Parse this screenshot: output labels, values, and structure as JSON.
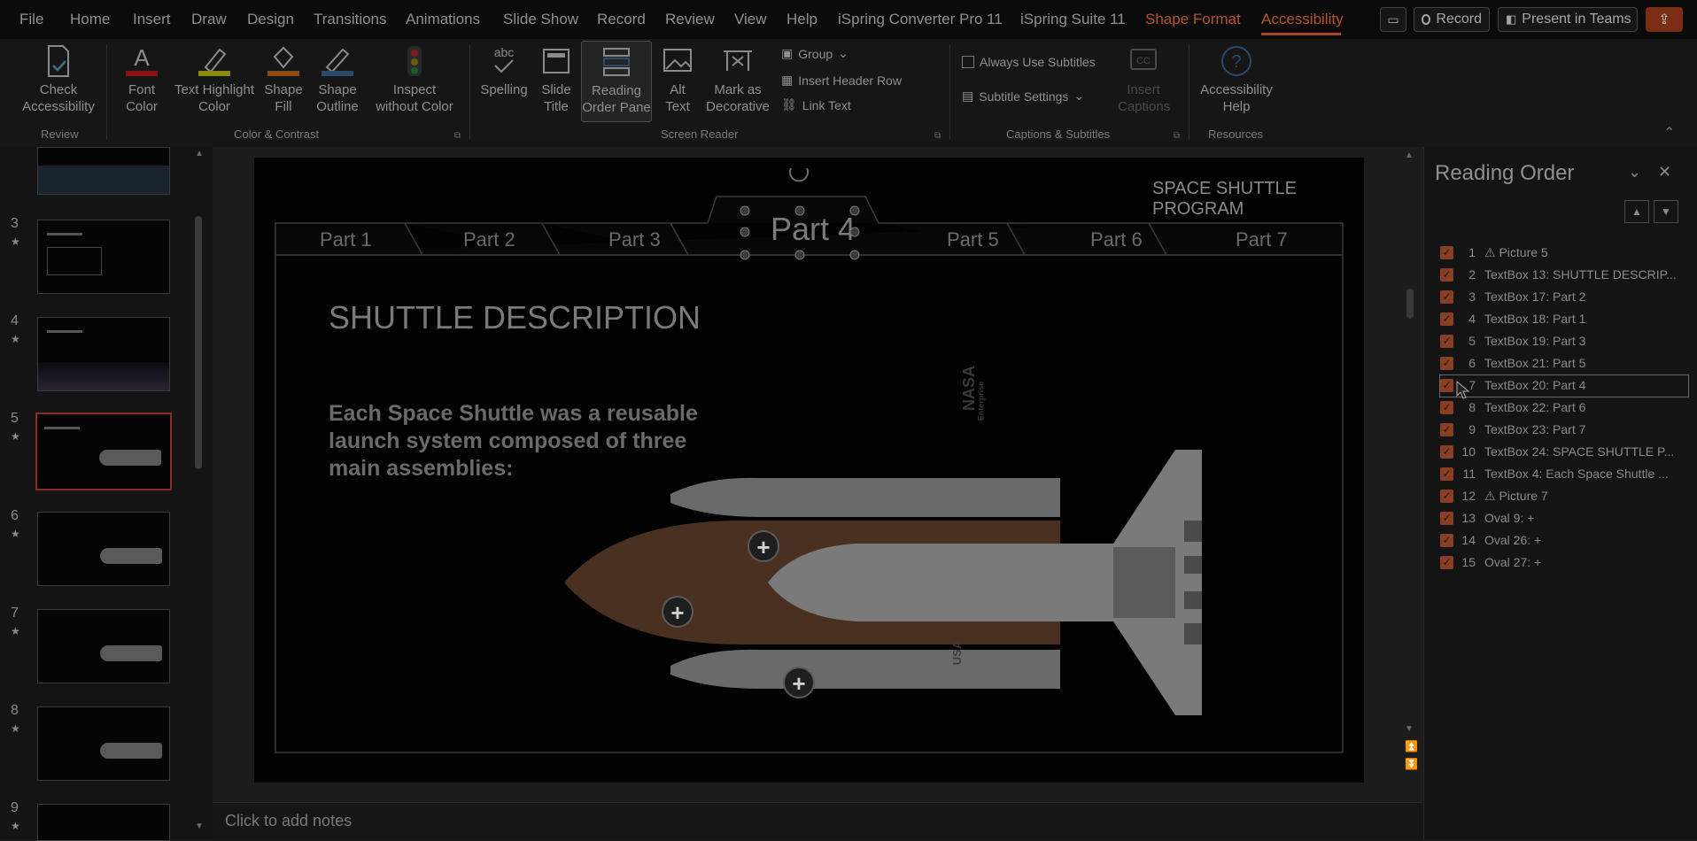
{
  "menubar": {
    "items": [
      "File",
      "Home",
      "Insert",
      "Draw",
      "Design",
      "Transitions",
      "Animations",
      "Slide Show",
      "Record",
      "Review",
      "View",
      "Help",
      "iSpring Converter Pro 11",
      "iSpring Suite 11"
    ],
    "shape_format": "Shape Format",
    "accessibility": "Accessibility",
    "record_btn": "Record",
    "present_btn": "Present in Teams"
  },
  "ribbon": {
    "check_accessibility": "Check\nAccessibility",
    "font_color": "Font\nColor",
    "text_highlight": "Text Highlight\nColor",
    "shape_fill": "Shape\nFill",
    "shape_outline": "Shape\nOutline",
    "inspect": "Inspect\nwithout Color",
    "spelling": "Spelling",
    "slide_title": "Slide\nTitle",
    "reading_order": "Reading\nOrder Pane",
    "alt_text": "Alt\nText",
    "mark_decorative": "Mark as\nDecorative",
    "group": "Group",
    "insert_header_row": "Insert Header Row",
    "link_text": "Link Text",
    "always_subtitles": "Always Use Subtitles",
    "subtitle_settings": "Subtitle Settings",
    "insert_captions": "Insert\nCaptions",
    "accessibility_help": "Accessibility\nHelp",
    "groups": {
      "review": "Review",
      "color_contrast": "Color & Contrast",
      "screen_reader": "Screen Reader",
      "captions": "Captions & Subtitles",
      "resources": "Resources"
    }
  },
  "thumbnails": [
    {
      "num": "3",
      "star": "★"
    },
    {
      "num": "4",
      "star": "★"
    },
    {
      "num": "5",
      "star": "★"
    },
    {
      "num": "6",
      "star": "★"
    },
    {
      "num": "7",
      "star": "★"
    },
    {
      "num": "8",
      "star": "★"
    },
    {
      "num": "9",
      "star": "★"
    }
  ],
  "slide": {
    "program": "SPACE SHUTTLE PROGRAM",
    "tabs": [
      "Part 1",
      "Part 2",
      "Part 3",
      "Part 4",
      "Part 5",
      "Part 6",
      "Part 7"
    ],
    "heading": "SHUTTLE DESCRIPTION",
    "body": "Each Space Shuttle was a reusable launch system composed of three main assemblies:",
    "plus": "+",
    "shuttle_name": "NASA",
    "shuttle_sub": "Enterprise",
    "usa": "USA"
  },
  "notes": {
    "placeholder": "Click to add notes"
  },
  "reading_order": {
    "title": "Reading Order",
    "items": [
      {
        "num": "1",
        "label": "⚠ Picture 5"
      },
      {
        "num": "2",
        "label": "TextBox 13: SHUTTLE DESCRIP..."
      },
      {
        "num": "3",
        "label": "TextBox 17: Part 2"
      },
      {
        "num": "4",
        "label": "TextBox 18: Part 1"
      },
      {
        "num": "5",
        "label": "TextBox 19: Part 3"
      },
      {
        "num": "6",
        "label": "TextBox 21: Part 5"
      },
      {
        "num": "7",
        "label": "TextBox 20: Part 4"
      },
      {
        "num": "8",
        "label": "TextBox 22: Part 6"
      },
      {
        "num": "9",
        "label": "TextBox 23: Part 7"
      },
      {
        "num": "10",
        "label": "TextBox 24: SPACE SHUTTLE P..."
      },
      {
        "num": "11",
        "label": "TextBox 4: Each Space Shuttle ..."
      },
      {
        "num": "12",
        "label": "⚠ Picture 7"
      },
      {
        "num": "13",
        "label": "Oval 9: +"
      },
      {
        "num": "14",
        "label": "Oval 26: +"
      },
      {
        "num": "15",
        "label": "Oval 27: +"
      }
    ]
  },
  "colors": {
    "accent": "#b7532a",
    "checkbox": "#8a3f24",
    "slide_bg": "#020202"
  }
}
